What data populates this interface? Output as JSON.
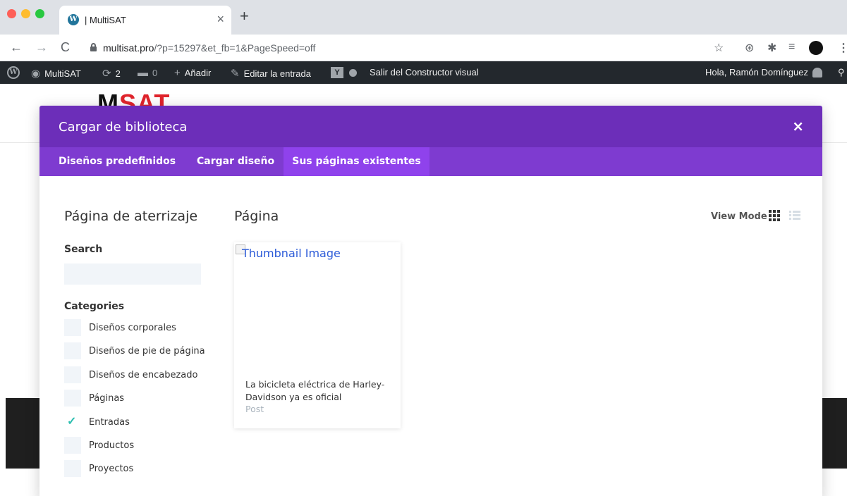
{
  "browser": {
    "tab_title": "| MultiSAT",
    "tab_close": "×",
    "new_tab": "+",
    "url_host": "multisat.pro",
    "url_path": "/?p=15297&et_fb=1&PageSpeed=off",
    "back": "←",
    "forward": "→",
    "reload": "C",
    "star": "☆",
    "menu": "⋮"
  },
  "adminbar": {
    "site_name": "MultiSAT",
    "updates_count": "2",
    "comments_count": "0",
    "new_label": "Añadir",
    "edit_label": "Editar la entrada",
    "exit_label": "Salir del Constructor visual",
    "howdy": "Hola, Ramón Domínguez"
  },
  "modal": {
    "title": "Cargar de biblioteca",
    "close": "×",
    "tabs": [
      {
        "label": "Diseños predefinidos",
        "active": false
      },
      {
        "label": "Cargar diseño",
        "active": false
      },
      {
        "label": "Sus páginas existentes",
        "active": true
      }
    ],
    "sidebar": {
      "title": "Página de aterrizaje",
      "search_label": "Search",
      "search_value": "",
      "categories_label": "Categories",
      "categories": [
        {
          "label": "Diseños corporales",
          "checked": false
        },
        {
          "label": "Diseños de pie de página",
          "checked": false
        },
        {
          "label": "Diseños de encabezado",
          "checked": false
        },
        {
          "label": "Páginas",
          "checked": false
        },
        {
          "label": "Entradas",
          "checked": true
        },
        {
          "label": "Productos",
          "checked": false
        },
        {
          "label": "Proyectos",
          "checked": false
        }
      ]
    },
    "content": {
      "title": "Página",
      "view_mode_label": "View Mode",
      "cards": [
        {
          "thumbnail_alt": "Thumbnail Image",
          "title": "La bicicleta eléctrica de Harley-Davidson ya es oficial",
          "type": "Post"
        }
      ]
    }
  },
  "colors": {
    "header": "#6c2eb9",
    "tabs": "#7e3bd0",
    "active_tab": "#8f42ec",
    "check": "#2ebfb1"
  }
}
